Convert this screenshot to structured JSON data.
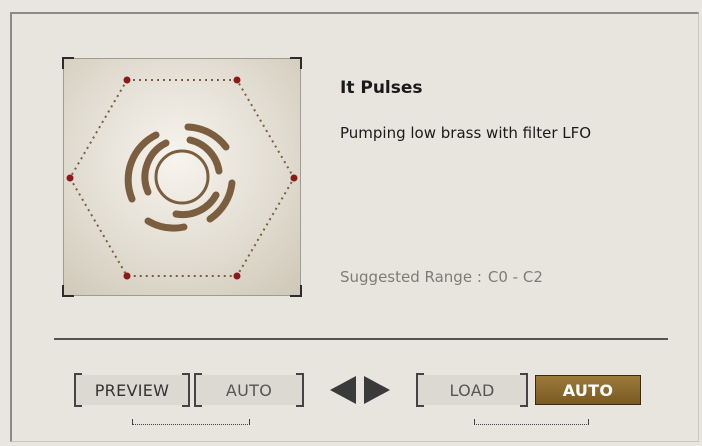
{
  "preset": {
    "title": "It Pulses",
    "description": "Pumping low brass with filter LFO",
    "range_label": "Suggested Range :",
    "range_value": "C0 - C2"
  },
  "controls": {
    "preview_label": "PREVIEW",
    "auto_label_1": "AUTO",
    "load_label": "LOAD",
    "auto_label_2": "AUTO"
  },
  "icons": {
    "artwork": "pulse-rings-icon",
    "prev": "arrow-left-icon",
    "next": "arrow-right-icon"
  },
  "colors": {
    "accent": "#8a6a30",
    "ring": "#7b5e3f",
    "node": "#8b1a1a"
  }
}
